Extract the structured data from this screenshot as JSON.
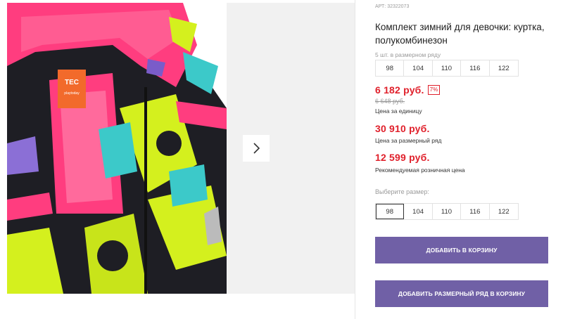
{
  "product": {
    "article": "АРТ: 32322073",
    "title": "Комплект зимний для девочки: куртка, полукомбинезон",
    "row_note": "5 шт. в размерном ряду",
    "row_sizes": [
      "98",
      "104",
      "110",
      "116",
      "122"
    ],
    "price_unit": "6 182 руб.",
    "discount": "7%",
    "price_old": "6 648 руб.",
    "price_unit_caption": "Цена за единицу",
    "price_row": "30 910 руб.",
    "price_row_caption": "Цена за размерный ряд",
    "price_rrp": "12 599 руб.",
    "price_rrp_caption": "Рекомендуемая розничная цена",
    "select_label": "Выберите размер:",
    "sizes": [
      "98",
      "104",
      "110",
      "116",
      "122"
    ],
    "selected_size": "98"
  },
  "photo": {
    "label_brand": "TEC",
    "label_sub": "playtoday"
  },
  "buttons": {
    "add_to_cart": "ДОБАВИТЬ В КОРЗИНУ",
    "add_row_to_cart": "ДОБАВИТЬ РАЗМЕРНЫЙ РЯД В КОРЗИНУ"
  },
  "colors": {
    "price_red": "#e0202b",
    "button_purple": "#7060a6",
    "jacket_pink": "#ff3d7f",
    "jacket_lime": "#d4f01e",
    "jacket_cyan": "#3cc9c9",
    "label_orange": "#f26a2b"
  },
  "icons": {
    "gallery_next": "chevron-right-icon"
  }
}
